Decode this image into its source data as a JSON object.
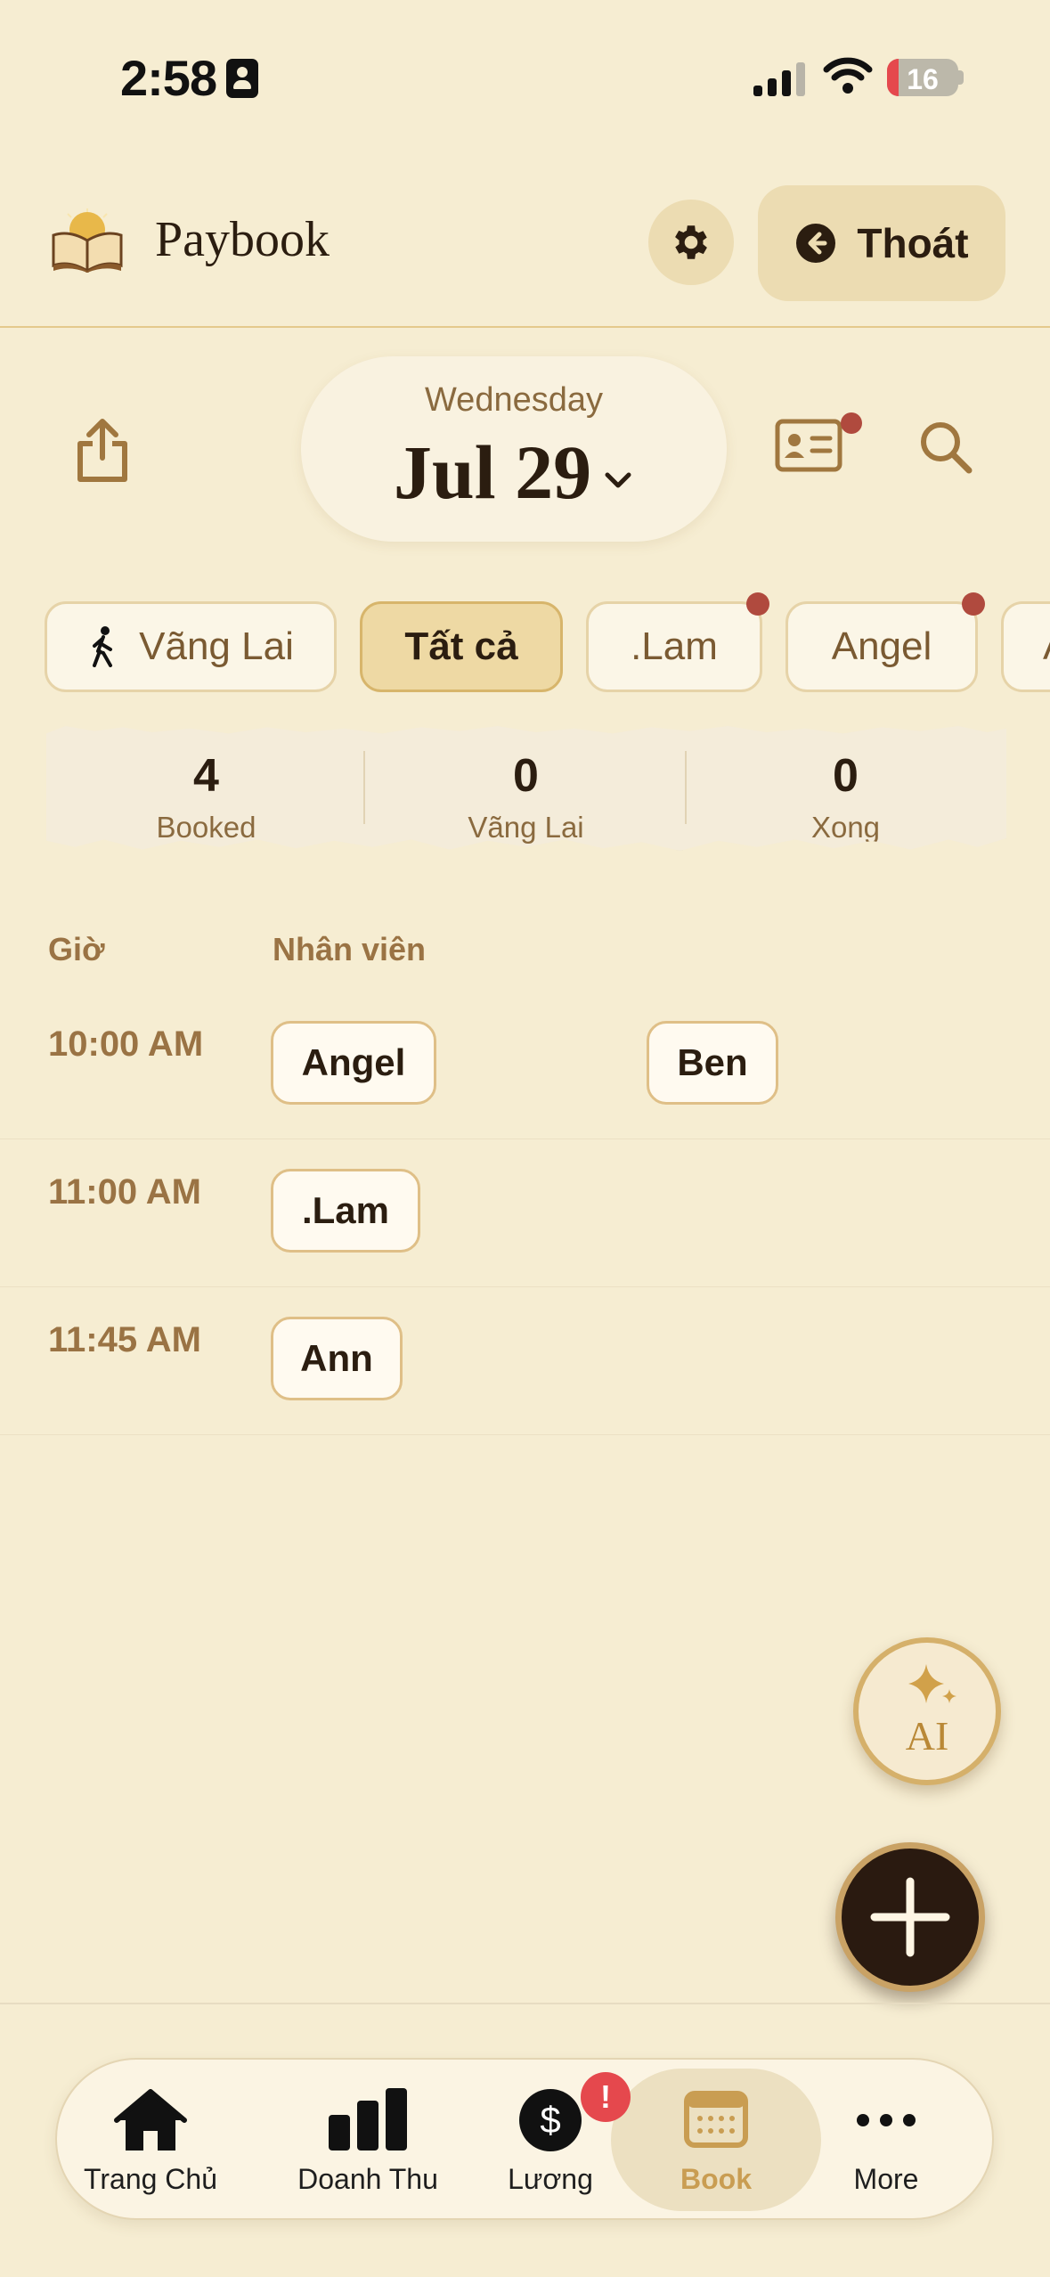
{
  "status_bar": {
    "time": "2:58",
    "battery": "16",
    "battery_level": 0.16
  },
  "header": {
    "app_title": "Paybook",
    "exit_label": "Thoát"
  },
  "date_picker": {
    "weekday": "Wednesday",
    "date": "Jul 29"
  },
  "filters": [
    {
      "label": "Vãng Lai",
      "icon": "walking-person-icon",
      "active": false,
      "badge": false
    },
    {
      "label": "Tất cả",
      "active": true,
      "badge": false
    },
    {
      "label": ".Lam",
      "active": false,
      "badge": true
    },
    {
      "label": "Angel",
      "active": false,
      "badge": true
    },
    {
      "label": "A",
      "active": false,
      "badge": false
    }
  ],
  "stats": [
    {
      "value": "4",
      "label": "Booked"
    },
    {
      "value": "0",
      "label": "Vãng Lai"
    },
    {
      "value": "0",
      "label": "Xong"
    }
  ],
  "schedule": {
    "headers": {
      "time": "Giờ",
      "staff": "Nhân viên"
    },
    "rows": [
      {
        "time": "10:00 AM",
        "staff": [
          "Angel",
          "Ben"
        ]
      },
      {
        "time": "11:00 AM",
        "staff": [
          ".Lam"
        ]
      },
      {
        "time": "11:45 AM",
        "staff": [
          "Ann"
        ]
      }
    ]
  },
  "ai_button": {
    "label": "AI"
  },
  "tabs": [
    {
      "label": "Trang Chủ",
      "icon": "home-icon"
    },
    {
      "label": "Doanh Thu",
      "icon": "bar-chart-icon"
    },
    {
      "label": "Lương",
      "icon": "dollar-icon",
      "badge": "!"
    },
    {
      "label": "Book",
      "icon": "calendar-icon",
      "active": true
    },
    {
      "label": "More",
      "icon": "more-dots-icon"
    }
  ],
  "colors": {
    "background": "#f6edd2",
    "accent": "#c99d52",
    "badge": "#b04a3e",
    "brown_text": "#9a7344"
  }
}
